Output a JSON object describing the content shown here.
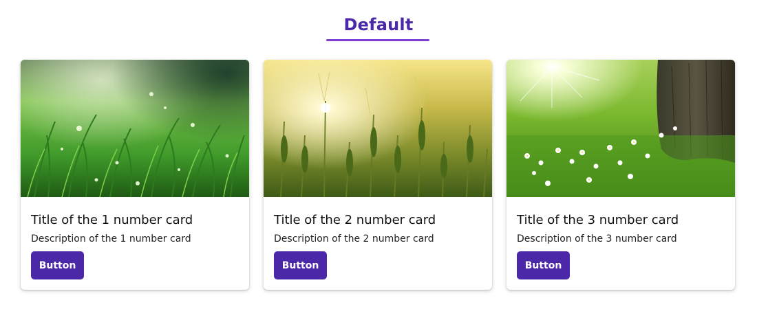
{
  "section": {
    "title": "Default"
  },
  "cards": [
    {
      "title": "Title of the 1 number card",
      "description": "Description of the 1 number card",
      "button_label": "Button",
      "image_alt": "grass-with-dew-image"
    },
    {
      "title": "Title of the 2 number card",
      "description": "Description of the 2 number card",
      "button_label": "Button",
      "image_alt": "wheat-field-image"
    },
    {
      "title": "Title of the 3 number card",
      "description": "Description of the 3 number card",
      "button_label": "Button",
      "image_alt": "tree-meadow-flowers-image"
    }
  ],
  "colors": {
    "accent": "#4a28a8",
    "underline": "#7d3fd0"
  }
}
